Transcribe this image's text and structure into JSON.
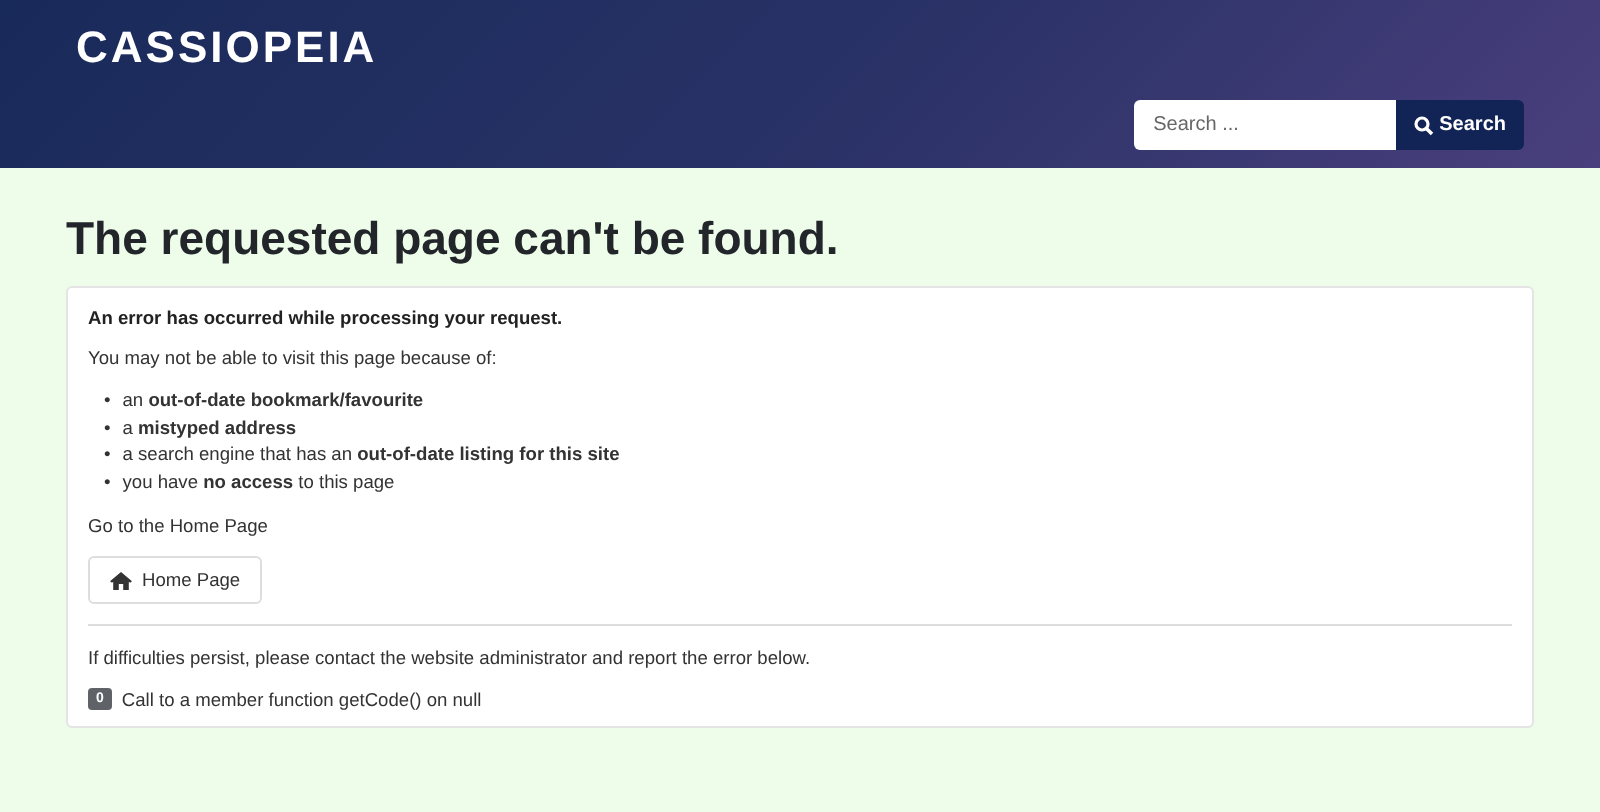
{
  "header": {
    "logo": "CASSIOPEIA",
    "search": {
      "placeholder": "Search ...",
      "button": "Search"
    }
  },
  "page": {
    "title": "The requested page can't be found.",
    "error_heading": "An error has occurred while processing your request.",
    "intro": "You may not be able to visit this page because of:",
    "reasons": [
      {
        "bullet": "•",
        "text": "an **out-of-date bookmark/favourite**"
      },
      {
        "bullet": "•",
        "text": "a **mistyped address**"
      },
      {
        "bullet": "•",
        "text": "a search engine that has an **out-of-date listing for this site**"
      },
      {
        "bullet": "•",
        "text": "you have **no access** to this page"
      }
    ],
    "home_text": "Go to the Home Page",
    "home_button": "Home Page",
    "contact_text": "If difficulties persist, please contact the website administrator and report the error below.",
    "error_code": "0",
    "error_message": "Call to a member function getCode() on null"
  }
}
